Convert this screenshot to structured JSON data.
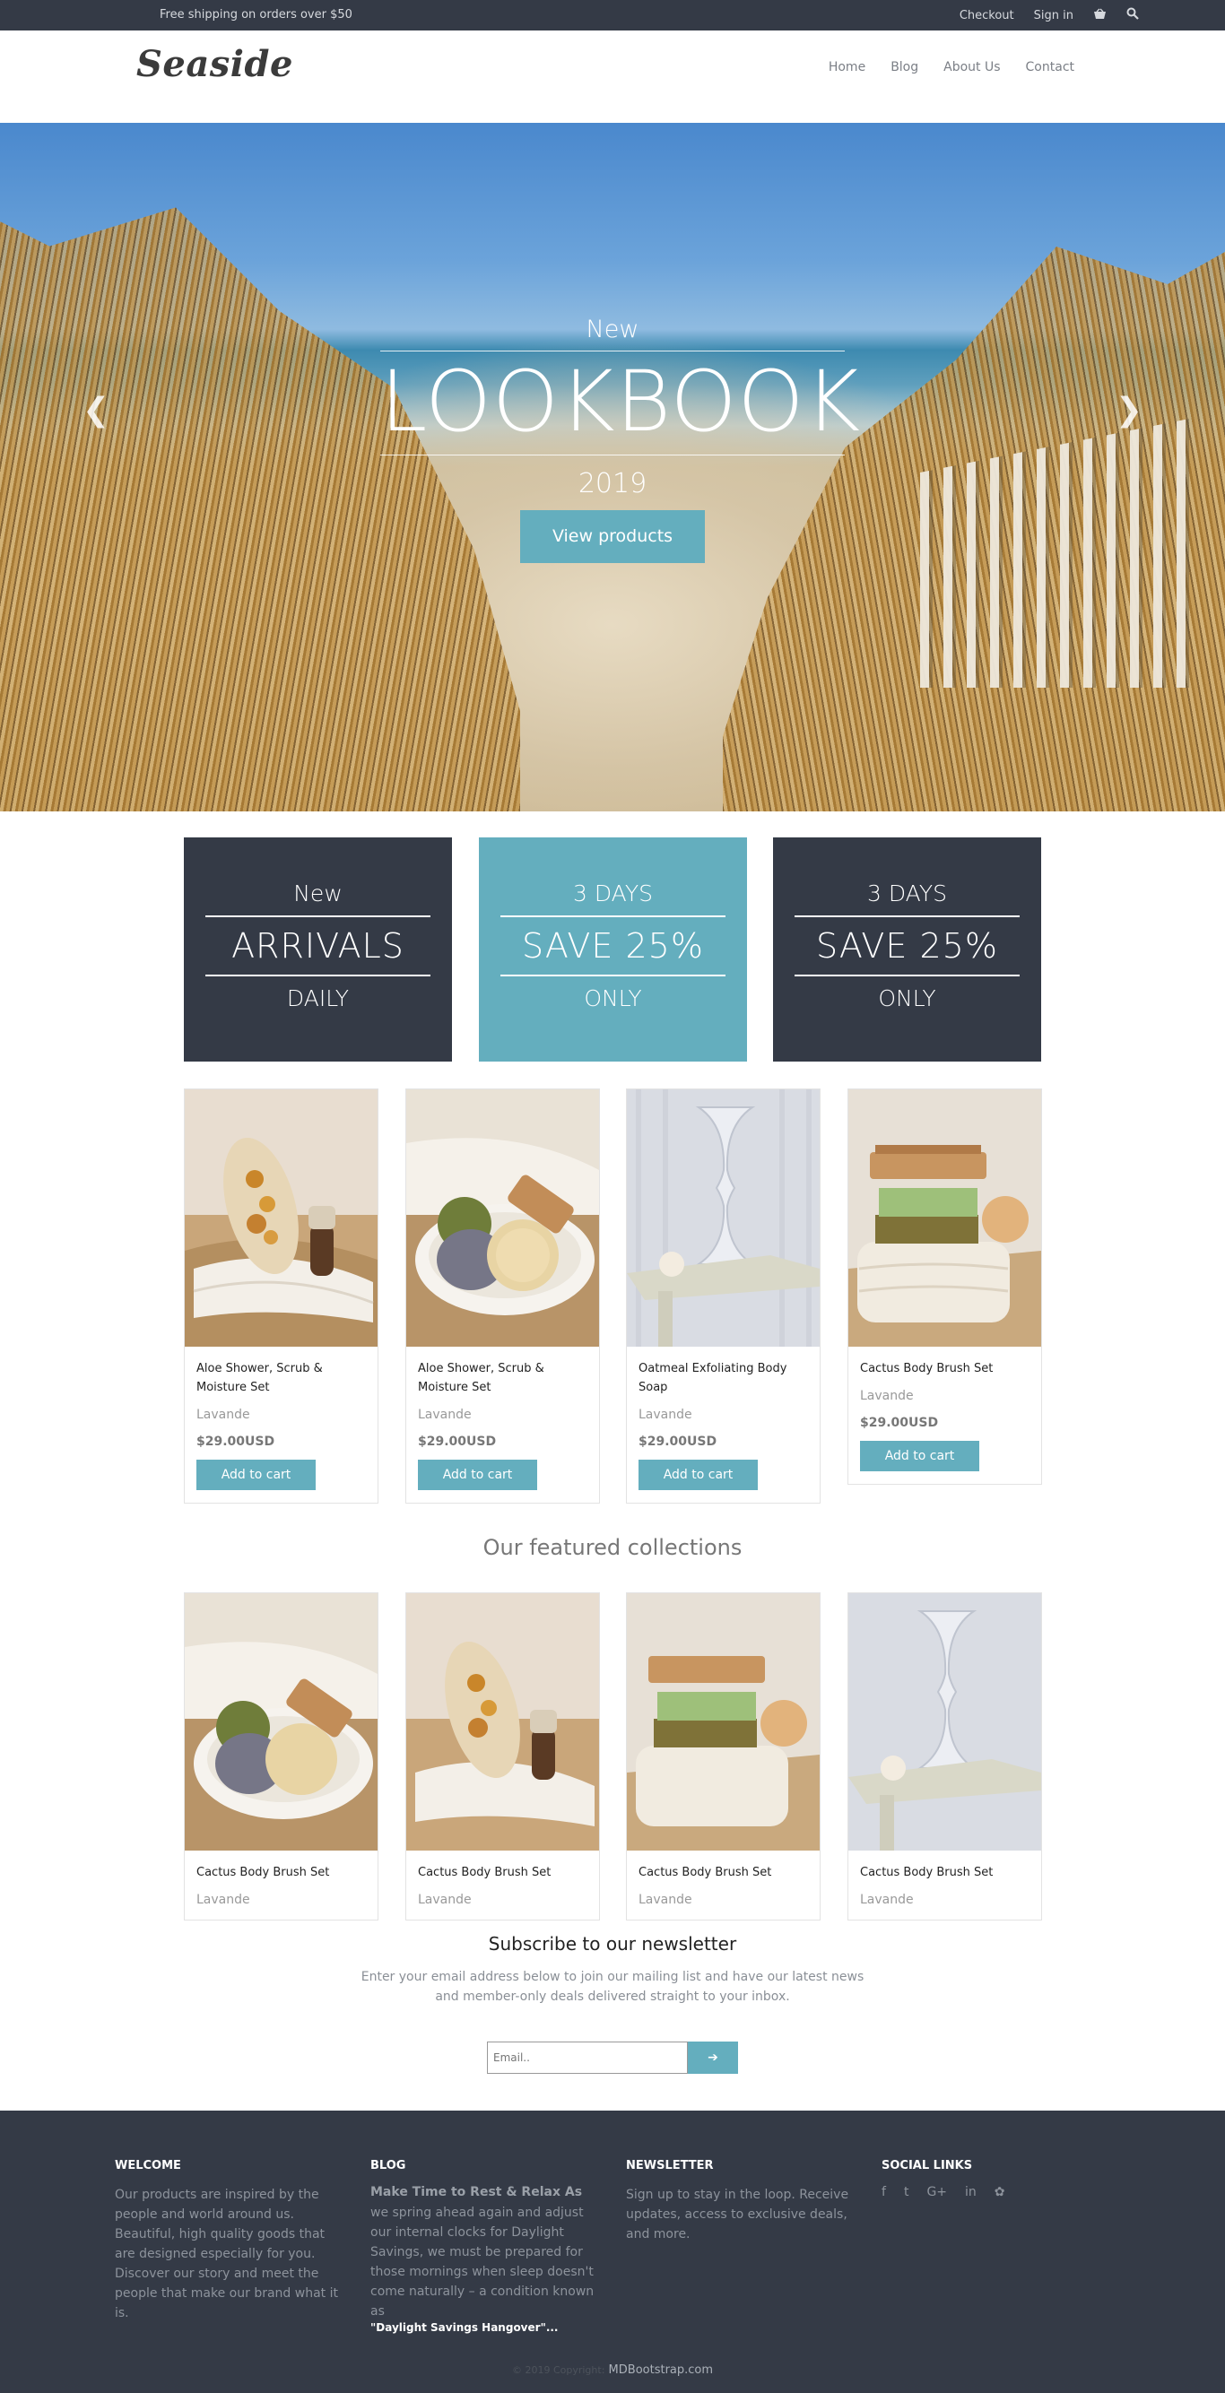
{
  "topbar": {
    "shipping": "Free shipping on orders over $50",
    "checkout": "Checkout",
    "signin": "Sign in",
    "cart_icon": "basket-icon",
    "search_icon": "search-icon"
  },
  "header": {
    "logo": "Seaside",
    "nav": [
      "Home",
      "Blog",
      "About Us",
      "Contact"
    ]
  },
  "hero": {
    "kicker": "New",
    "title": "LOOKBOOK",
    "year": "2019",
    "button": "View products",
    "prev_icon": "chevron-left-icon",
    "next_icon": "chevron-right-icon"
  },
  "promos": [
    {
      "top": "New",
      "big": "ARRIVALS",
      "bottom": "DAILY",
      "color": "#343a46"
    },
    {
      "top": "3 DAYS",
      "big": "SAVE 25%",
      "bottom": "ONLY",
      "color": "#64aebe"
    },
    {
      "top": "3 DAYS",
      "big": "SAVE 25%",
      "bottom": "ONLY",
      "color": "#343a46"
    }
  ],
  "products": [
    {
      "name": "Aloe Shower, Scrub & Moisture Set",
      "brand": "Lavande",
      "price": "$29.00USD",
      "button": "Add to cart"
    },
    {
      "name": "Aloe Shower, Scrub & Moisture Set",
      "brand": "Lavande",
      "price": "$29.00USD",
      "button": "Add to cart"
    },
    {
      "name": "Oatmeal Exfoliating Body Soap",
      "brand": "Lavande",
      "price": "$29.00USD",
      "button": "Add to cart"
    },
    {
      "name": "Cactus Body Brush Set",
      "brand": "Lavande",
      "price": "$29.00USD",
      "button": "Add to cart"
    }
  ],
  "collections_title": "Our featured collections",
  "collections": [
    {
      "name": "Cactus Body Brush Set",
      "brand": "Lavande"
    },
    {
      "name": "Cactus Body Brush Set",
      "brand": "Lavande"
    },
    {
      "name": "Cactus Body Brush Set",
      "brand": "Lavande"
    },
    {
      "name": "Cactus Body Brush Set",
      "brand": "Lavande"
    }
  ],
  "newsletter": {
    "title": "Subscribe to our newsletter",
    "text": "Enter your email address below to join our mailing list and have our latest news and member-only deals delivered straight to your inbox.",
    "placeholder": "Email..",
    "submit_icon": "arrow-right-icon"
  },
  "footer": {
    "welcome_head": "WELCOME",
    "welcome_text": "Our products are inspired by the people and world around us. Beautiful, high quality goods that are designed especially for you. Discover our story and meet the people that make our brand what it is.",
    "blog_head": "BLOG",
    "blog_title": "Make Time to Rest & Relax As",
    "blog_text": "we spring ahead again and adjust our internal clocks for Daylight Savings, we must be prepared for those mornings when sleep doesn't come naturally – a condition known as",
    "blog_strong": "\"Daylight Savings Hangover\"...",
    "news_head": "NEWSLETTER",
    "news_text": "Sign up to stay in the loop. Receive updates, access to exclusive deals, and more.",
    "social_head": "SOCIAL LINKS",
    "social": [
      "f",
      "t",
      "G+",
      "in",
      "✿"
    ],
    "copyright": "© 2019 Copyright:",
    "copyright_link": "MDBootstrap.com"
  }
}
